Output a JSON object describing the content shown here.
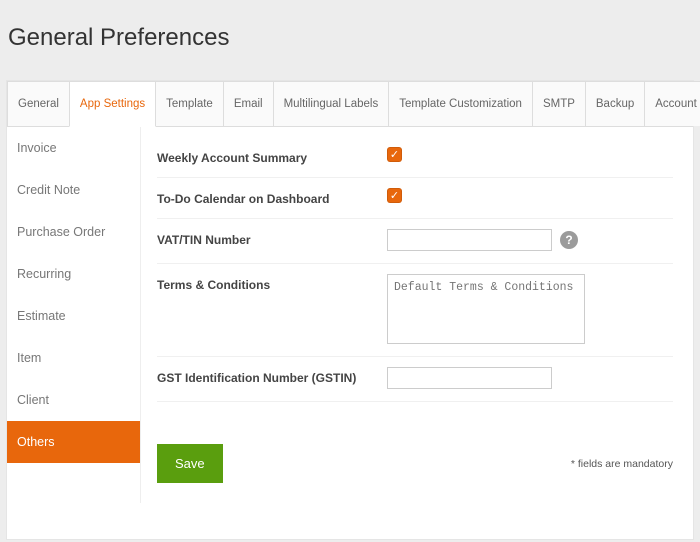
{
  "title": "General Preferences",
  "tabs": {
    "general": "General",
    "app_settings": "App Settings",
    "template": "Template",
    "email": "Email",
    "multilingual": "Multilingual Labels",
    "template_custom": "Template Customization",
    "smtp": "SMTP",
    "backup": "Backup",
    "account_merge": "Account Merge"
  },
  "sidebar": {
    "invoice": "Invoice",
    "credit_note": "Credit Note",
    "purchase_order": "Purchase Order",
    "recurring": "Recurring",
    "estimate": "Estimate",
    "item": "Item",
    "client": "Client",
    "others": "Others"
  },
  "form": {
    "weekly_summary_label": "Weekly Account Summary",
    "weekly_summary_checked": true,
    "todo_label": "To-Do Calendar on Dashboard",
    "todo_checked": true,
    "vat_label": "VAT/TIN Number",
    "vat_value": "",
    "terms_label": "Terms & Conditions",
    "terms_placeholder": "Default Terms & Conditions",
    "terms_value": "",
    "gstin_label": "GST Identification Number (GSTIN)",
    "gstin_value": ""
  },
  "footer": {
    "save": "Save",
    "mandatory": "* fields are mandatory"
  },
  "icons": {
    "check": "✓",
    "help": "?"
  }
}
